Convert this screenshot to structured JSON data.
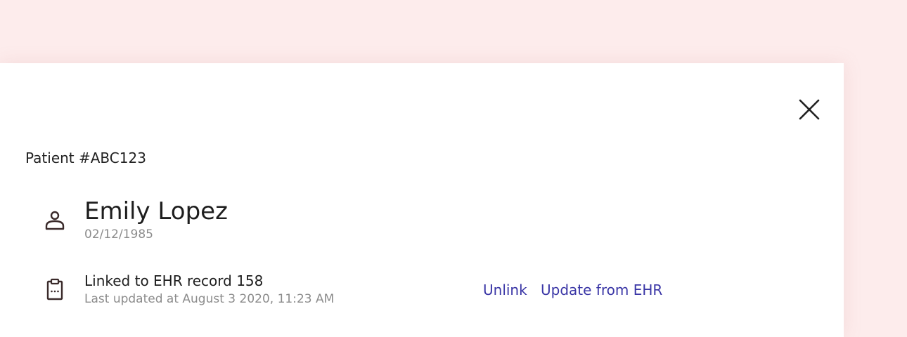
{
  "patient": {
    "id_label": "Patient #ABC123",
    "name": "Emily Lopez",
    "dob": "02/12/1985"
  },
  "ehr": {
    "title": "Linked to EHR record 158",
    "updated": "Last updated at August 3 2020, 11:23 AM",
    "unlink_label": "Unlink",
    "update_label": "Update from EHR"
  },
  "icons": {
    "close": "close-icon",
    "person": "person-icon",
    "clipboard": "clipboard-icon"
  },
  "colors": {
    "background": "#fdecec",
    "panel": "#ffffff",
    "link": "#3a36a6",
    "text": "#1e1e1e",
    "muted": "#8c8c8c"
  }
}
